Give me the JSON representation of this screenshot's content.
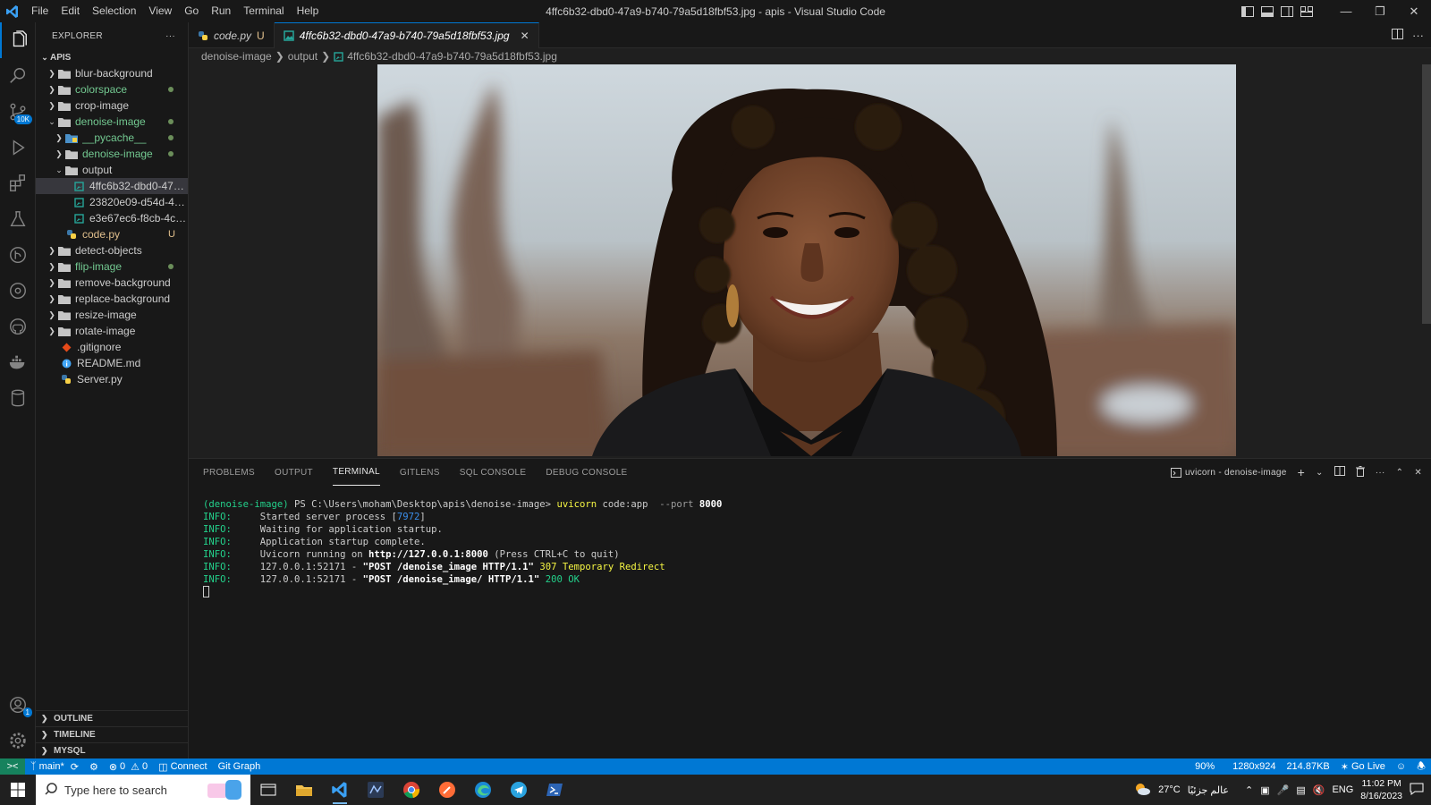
{
  "titlebar": {
    "menu": [
      "File",
      "Edit",
      "Selection",
      "View",
      "Go",
      "Run",
      "Terminal",
      "Help"
    ],
    "title": "4ffc6b32-dbd0-47a9-b740-79a5d18fbf53.jpg - apis - Visual Studio Code"
  },
  "activitybar": {
    "scm_badge": "10K",
    "accounts_badge": "1"
  },
  "sidebar": {
    "header": "EXPLORER",
    "more": "···",
    "root": "APIS",
    "items": [
      {
        "label": "blur-background",
        "type": "folder",
        "indent": 0,
        "expanded": false,
        "state": "",
        "decoration": ""
      },
      {
        "label": "colorspace",
        "type": "folder",
        "indent": 0,
        "expanded": false,
        "state": "green",
        "decoration": "dot"
      },
      {
        "label": "crop-image",
        "type": "folder",
        "indent": 0,
        "expanded": false,
        "state": "",
        "decoration": ""
      },
      {
        "label": "denoise-image",
        "type": "folder",
        "indent": 0,
        "expanded": true,
        "state": "green",
        "decoration": "dot"
      },
      {
        "label": "__pycache__",
        "type": "pyfolder",
        "indent": 1,
        "expanded": false,
        "state": "green",
        "decoration": "dot"
      },
      {
        "label": "denoise-image",
        "type": "folder",
        "indent": 1,
        "expanded": false,
        "state": "green",
        "decoration": "dot"
      },
      {
        "label": "output",
        "type": "folder",
        "indent": 1,
        "expanded": true,
        "state": "",
        "decoration": ""
      },
      {
        "label": "4ffc6b32-dbd0-47a9-...",
        "type": "image",
        "indent": 2,
        "expanded": null,
        "state": "",
        "decoration": "",
        "selected": true
      },
      {
        "label": "23820e09-d54d-4d1...",
        "type": "image",
        "indent": 2,
        "expanded": null,
        "state": "",
        "decoration": ""
      },
      {
        "label": "e3e67ec6-f8cb-4cc6-...",
        "type": "image",
        "indent": 2,
        "expanded": null,
        "state": "",
        "decoration": ""
      },
      {
        "label": "code.py",
        "type": "python",
        "indent": 1,
        "expanded": null,
        "state": "yellowish",
        "decoration": "U"
      },
      {
        "label": "detect-objects",
        "type": "folder",
        "indent": 0,
        "expanded": false,
        "state": "",
        "decoration": ""
      },
      {
        "label": "flip-image",
        "type": "folder",
        "indent": 0,
        "expanded": false,
        "state": "green",
        "decoration": "dot"
      },
      {
        "label": "remove-background",
        "type": "folder",
        "indent": 0,
        "expanded": false,
        "state": "",
        "decoration": ""
      },
      {
        "label": "replace-background",
        "type": "folder",
        "indent": 0,
        "expanded": false,
        "state": "",
        "decoration": ""
      },
      {
        "label": "resize-image",
        "type": "folder",
        "indent": 0,
        "expanded": false,
        "state": "",
        "decoration": ""
      },
      {
        "label": "rotate-image",
        "type": "folder",
        "indent": 0,
        "expanded": false,
        "state": "",
        "decoration": ""
      },
      {
        "label": ".gitignore",
        "type": "git",
        "indent": -1,
        "expanded": null,
        "state": "",
        "decoration": ""
      },
      {
        "label": "README.md",
        "type": "info",
        "indent": -1,
        "expanded": null,
        "state": "",
        "decoration": ""
      },
      {
        "label": "Server.py",
        "type": "python",
        "indent": -1,
        "expanded": null,
        "state": "",
        "decoration": ""
      }
    ],
    "sections": [
      "OUTLINE",
      "TIMELINE",
      "MYSQL"
    ]
  },
  "tabs": [
    {
      "label": "code.py",
      "modified": "U",
      "active": false
    },
    {
      "label": "4ffc6b32-dbd0-47a9-b740-79a5d18fbf53.jpg",
      "modified": "",
      "active": true
    }
  ],
  "breadcrumb": [
    "denoise-image",
    "output",
    "4ffc6b32-dbd0-47a9-b740-79a5d18fbf53.jpg"
  ],
  "panel": {
    "tabs": [
      "PROBLEMS",
      "OUTPUT",
      "TERMINAL",
      "GITLENS",
      "SQL CONSOLE",
      "DEBUG CONSOLE"
    ],
    "active_tab": "TERMINAL",
    "terminal_name": "uvicorn - denoise-image"
  },
  "terminal": {
    "env": "(denoise-image)",
    "prompt": " PS C:\\Users\\moham\\Desktop\\apis\\denoise-image> ",
    "cmd": "uvicorn",
    "args": " code:app ",
    "flag": " --port ",
    "port": "8000",
    "lines": [
      {
        "level": "INFO:",
        "text": "     Started server process [",
        "hl": "7972",
        "tail": "]"
      },
      {
        "level": "INFO:",
        "text": "     Waiting for application startup.",
        "hl": "",
        "tail": ""
      },
      {
        "level": "INFO:",
        "text": "     Application startup complete.",
        "hl": "",
        "tail": ""
      },
      {
        "level": "INFO:",
        "text": "     Uvicorn running on ",
        "bold": "http://127.0.0.1:8000",
        "tail": " (Press CTRL+C to quit)"
      },
      {
        "level": "INFO:",
        "text": "     127.0.0.1:52171 - ",
        "bold": "\"POST /denoise_image HTTP/1.1\"",
        "status": " 307 Temporary Redirect",
        "status_color": "yellow"
      },
      {
        "level": "INFO:",
        "text": "     127.0.0.1:52171 - ",
        "bold": "\"POST /denoise_image/ HTTP/1.1\"",
        "status": " 200 OK",
        "status_color": "green"
      }
    ]
  },
  "statusbar": {
    "branch": "main*",
    "errors": "0",
    "warnings": "0",
    "connect": "Connect",
    "gitgraph": "Git Graph",
    "zoom": "90%",
    "dimensions": "1280x924",
    "filesize": "214.87KB",
    "golive": "Go Live"
  },
  "taskbar": {
    "search_placeholder": "Type here to search",
    "weather": "27°C",
    "weather_text": "عالم جزئيًا",
    "lang": "ENG",
    "time": "11:02 PM",
    "date": "8/16/2023"
  }
}
